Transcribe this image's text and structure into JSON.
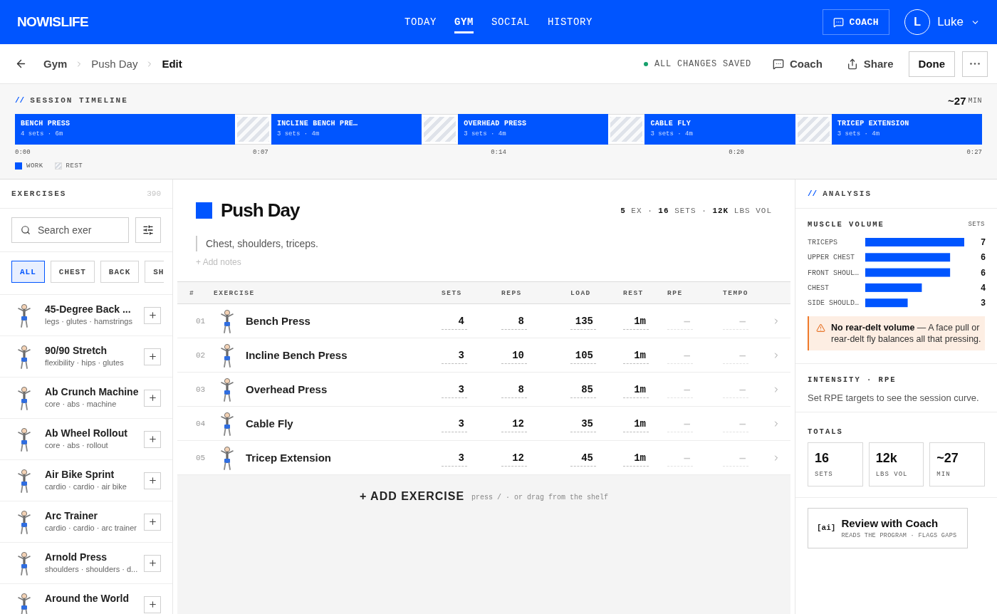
{
  "app": {
    "logo": "NOWISLIFE",
    "nav": [
      {
        "label": "TODAY",
        "selected": false
      },
      {
        "label": "GYM",
        "selected": true
      },
      {
        "label": "SOCIAL",
        "selected": false
      },
      {
        "label": "HISTORY",
        "selected": false
      }
    ],
    "coach_button": "COACH",
    "user": {
      "initial": "L",
      "name": "Luke"
    }
  },
  "toolbar": {
    "breadcrumb": [
      {
        "label": "Gym",
        "current": false
      },
      {
        "label": "Push Day",
        "current": false
      },
      {
        "label": "Edit",
        "current": true
      }
    ],
    "save_status": "ALL CHANGES SAVED",
    "actions": [
      {
        "kind": "coach",
        "label": "Coach"
      },
      {
        "kind": "share",
        "label": "Share"
      }
    ],
    "done_button": "Done"
  },
  "timeline": {
    "prefix": "//",
    "title": "SESSION TIMELINE",
    "total_value": "~27",
    "total_unit": "MIN",
    "segments": [
      {
        "kind": "work",
        "name": "BENCH PRESS",
        "meta": "4 sets · 6m"
      },
      {
        "kind": "rest"
      },
      {
        "kind": "work",
        "name": "INCLINE BENCH PRE…",
        "meta": "3 sets · 4m"
      },
      {
        "kind": "rest"
      },
      {
        "kind": "work",
        "name": "OVERHEAD PRESS",
        "meta": "3 sets · 4m"
      },
      {
        "kind": "rest"
      },
      {
        "kind": "work",
        "name": "CABLE FLY",
        "meta": "3 sets · 4m"
      },
      {
        "kind": "rest"
      },
      {
        "kind": "work",
        "name": "TRICEP EXTENSION",
        "meta": "3 sets · 4m"
      }
    ],
    "ticks": [
      "0:00",
      "0:07",
      "0:14",
      "0:20",
      "0:27"
    ],
    "legend": [
      {
        "kind": "work",
        "label": "WORK"
      },
      {
        "kind": "rest",
        "label": "REST"
      }
    ]
  },
  "sidebar": {
    "title": "EXERCISES",
    "count": "390",
    "search": {
      "placeholder": "Search exer"
    },
    "filters": [
      {
        "label": "ALL",
        "selected": true
      },
      {
        "label": "CHEST",
        "selected": false
      },
      {
        "label": "BACK",
        "selected": false
      },
      {
        "label": "SH",
        "selected": false
      }
    ],
    "exercises": [
      {
        "name": "45-Degree Back ...",
        "tags": "legs · glutes · hamstrings"
      },
      {
        "name": "90/90 Stretch",
        "tags": "flexibility · hips · glutes"
      },
      {
        "name": "Ab Crunch Machine",
        "tags": "core · abs · machine"
      },
      {
        "name": "Ab Wheel Rollout",
        "tags": "core · abs · rollout"
      },
      {
        "name": "Air Bike Sprint",
        "tags": "cardio · cardio · air bike"
      },
      {
        "name": "Arc Trainer",
        "tags": "cardio · cardio · arc trainer"
      },
      {
        "name": "Arnold Press",
        "tags": "shoulders · shoulders · d..."
      },
      {
        "name": "Around the World"
      }
    ]
  },
  "workout": {
    "title": "Push Day",
    "stats": "**5** EX · **16** SETS · **12K** LBS VOL",
    "notes": "Chest, shoulders, triceps.",
    "add_notes": "+ Add notes",
    "table": {
      "columns": [
        "#",
        "EXERCISE",
        "SETS",
        "REPS",
        "LOAD",
        "REST",
        "RPE",
        "TEMPO"
      ],
      "rows": [
        {
          "index": "01",
          "name": "Bench Press",
          "sets": "4",
          "reps": "8",
          "load": "135",
          "rest": "1m",
          "rpe": "—",
          "tempo": "—"
        },
        {
          "index": "02",
          "name": "Incline Bench Press",
          "sets": "3",
          "reps": "10",
          "load": "105",
          "rest": "1m",
          "rpe": "—",
          "tempo": "—"
        },
        {
          "index": "03",
          "name": "Overhead Press",
          "sets": "3",
          "reps": "8",
          "load": "85",
          "rest": "1m",
          "rpe": "—",
          "tempo": "—"
        },
        {
          "index": "04",
          "name": "Cable Fly",
          "sets": "3",
          "reps": "12",
          "load": "35",
          "rest": "1m",
          "rpe": "—",
          "tempo": "—"
        },
        {
          "index": "05",
          "name": "Tricep Extension",
          "sets": "3",
          "reps": "12",
          "load": "45",
          "rest": "1m",
          "rpe": "—",
          "tempo": "—"
        }
      ]
    },
    "add_exercise": {
      "label": "+ ADD EXERCISE",
      "hint": "press / · or drag from the shelf"
    }
  },
  "analysis": {
    "prefix": "//",
    "title": "ANALYSIS",
    "muscle_volume": {
      "unit": "SETS",
      "chart_data": {
        "type": "bar",
        "orientation": "horizontal",
        "title": "MUSCLE VOLUME",
        "categories": [
          "TRICEPS",
          "UPPER CHEST",
          "FRONT SHOUL…",
          "CHEST",
          "SIDE SHOULD…"
        ],
        "values": [
          7,
          6,
          6,
          4,
          3
        ],
        "data_labels": true
      }
    },
    "alert": "**No rear-delt volume** — A face pull or rear-delt fly balances all that pressing.",
    "intensity": {
      "title": "INTENSITY · RPE",
      "text": "Set RPE targets to see the session curve."
    },
    "totals": {
      "title": "TOTALS",
      "cards": [
        {
          "value": "16",
          "label": "SETS"
        },
        {
          "value": "12k",
          "label": "LBS VOL"
        },
        {
          "value": "~27",
          "label": "MIN"
        }
      ]
    },
    "review_button": {
      "tag": "[ai]",
      "title": "Review with Coach",
      "subtitle": "READS THE PROGRAM · FLAGS GAPS"
    }
  }
}
